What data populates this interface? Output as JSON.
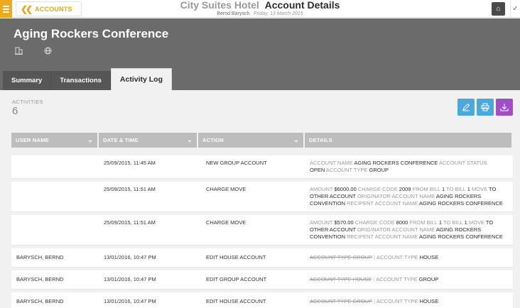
{
  "topbar": {
    "accounts_label": "ACCOUNTS",
    "hotel_name": "City Suites Hotel",
    "page_title": "Account Details",
    "user": "Bernd Barysch",
    "date": "Friday, 13 March 2015"
  },
  "header": {
    "account_name": "Aging Rockers Conference",
    "tabs": [
      {
        "label": "Summary",
        "active": false
      },
      {
        "label": "Transactions",
        "active": false
      },
      {
        "label": "Activity Log",
        "active": true
      }
    ]
  },
  "activities": {
    "label": "ACTIVITIES",
    "count": "6"
  },
  "table": {
    "columns": [
      "USER NAME",
      "DATE & TIME",
      "ACTION",
      "DETAILS"
    ],
    "rows": [
      {
        "user": "",
        "datetime": "25/09/2015, 11:45 AM",
        "action": "NEW GROUP ACCOUNT",
        "details": [
          {
            "label": "ACCOUNT NAME",
            "value": "AGING ROCKERS CONFERENCE"
          },
          {
            "label": "ACCOUNT STATUS",
            "value": "OPEN"
          },
          {
            "label": "ACCOUNT TYPE",
            "value": "GROUP"
          }
        ]
      },
      {
        "user": "",
        "datetime": "25/09/2015, 11:51 AM",
        "action": "CHARGE MOVE",
        "details": [
          {
            "label": "AMOUNT",
            "value": "$6000.00"
          },
          {
            "label": "CHARGE CODE",
            "value": "2009"
          },
          {
            "label": "FROM BILL",
            "value": "1"
          },
          {
            "label": "TO BILL",
            "value": "1"
          },
          {
            "label": "MOVE",
            "value": "TO OTHER ACCOUNT"
          },
          {
            "label": "ORIGINATOR ACCOUNT NAME",
            "value": "AGING ROCKERS CONVENTION"
          },
          {
            "label": "RECIPENT ACCOUNT NAME",
            "value": "AGING ROCKERS CONFERENCE"
          }
        ]
      },
      {
        "user": "",
        "datetime": "25/09/2015, 11:51 AM",
        "action": "CHARGE MOVE",
        "details": [
          {
            "label": "AMOUNT",
            "value": "$570.00"
          },
          {
            "label": "CHARGE CODE",
            "value": "8000"
          },
          {
            "label": "FROM BILL",
            "value": "1"
          },
          {
            "label": "TO BILL",
            "value": "1"
          },
          {
            "label": "MOVE",
            "value": "TO OTHER ACCOUNT"
          },
          {
            "label": "ORIGINATOR ACCOUNT NAME",
            "value": "AGING ROCKERS CONVENTION"
          },
          {
            "label": "RECIPENT ACCOUNT NAME",
            "value": "AGING ROCKERS CONFERENCE"
          }
        ]
      },
      {
        "user": "BARYSCH, BERND",
        "datetime": "13/01/2016, 10:47 PM",
        "action": "EDIT HOUSE ACCOUNT",
        "old": "ACCOUNT TYPE GROUP",
        "details": [
          {
            "label": "ACCOUNT TYPE",
            "value": "HOUSE"
          }
        ]
      },
      {
        "user": "BARYSCH, BERND",
        "datetime": "13/01/2016, 10:47 PM",
        "action": "EDIT GROUP ACCOUNT",
        "old": "ACCOUNT TYPE HOUSE",
        "details": [
          {
            "label": "ACCOUNT TYPE",
            "value": "GROUP"
          }
        ]
      },
      {
        "user": "BARYSCH, BERND",
        "datetime": "13/01/2016, 10:47 PM",
        "action": "EDIT HOUSE ACCOUNT",
        "old": "ACCOUNT TYPE GROUP",
        "details": [
          {
            "label": "ACCOUNT TYPE",
            "value": "HOUSE"
          }
        ]
      }
    ]
  },
  "icons": {
    "menu": "hamburger-icon",
    "back": "double-chevron-left-icon",
    "building": "building-icon",
    "globe": "globe-icon",
    "edit": "pencil-icon",
    "print": "printer-icon",
    "download": "download-icon"
  },
  "colors": {
    "accent": "#f0a81c",
    "header_bg": "#6b6b6b",
    "button_blue": "#4aa8dc",
    "button_purple": "#a14ec4"
  }
}
